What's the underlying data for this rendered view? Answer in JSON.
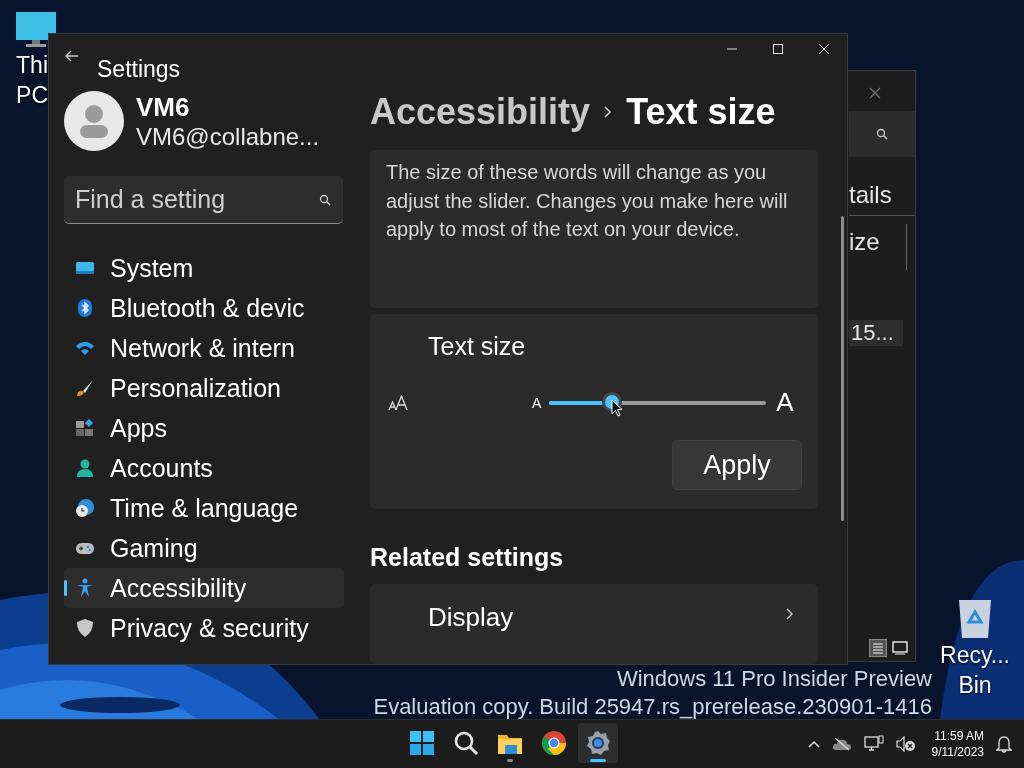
{
  "desktop": {
    "icons": [
      {
        "kind": "computer",
        "lines": [
          "Thi",
          "PC"
        ]
      },
      {
        "kind": "recycle_bin",
        "lines": [
          "Recy...",
          "Bin"
        ]
      }
    ],
    "watermark": [
      "Windows 11 Pro Insider Preview",
      "Evaluation copy. Build 25947.rs_prerelease.230901-1416"
    ]
  },
  "background_window": {
    "texts": [
      "tails",
      "ize",
      "15..."
    ]
  },
  "settings": {
    "window": {
      "title": "Settings"
    },
    "account": {
      "name": "VM6",
      "email": "VM6@collabne..."
    },
    "search": {
      "placeholder": "Find a setting"
    },
    "sidebar": {
      "items": [
        {
          "label": "System",
          "selected": false
        },
        {
          "label": "Bluetooth & devic",
          "selected": false
        },
        {
          "label": "Network & intern",
          "selected": false
        },
        {
          "label": "Personalization",
          "selected": false
        },
        {
          "label": "Apps",
          "selected": false
        },
        {
          "label": "Accounts",
          "selected": false
        },
        {
          "label": "Time & language",
          "selected": false
        },
        {
          "label": "Gaming",
          "selected": false
        },
        {
          "label": "Accessibility",
          "selected": true
        },
        {
          "label": "Privacy & security",
          "selected": false
        }
      ]
    },
    "breadcrumb": [
      "Accessibility",
      "Text size"
    ],
    "preview_text": "The size of these words will change as you adjust the slider. Changes you make here will apply to most of the text on your device.",
    "text_size": {
      "title": "Text size",
      "small_label": "A",
      "large_label": "A",
      "level": 0.29,
      "button": "Apply"
    },
    "related": {
      "heading": "Related settings",
      "items": [
        {
          "title": "Display"
        }
      ]
    }
  },
  "taskbar": {
    "apps": [
      {
        "kind": "start",
        "running": false,
        "active": false
      },
      {
        "kind": "search",
        "running": false,
        "active": false
      },
      {
        "kind": "explorer",
        "running": true,
        "active": false
      },
      {
        "kind": "browser",
        "running": false,
        "active": false
      },
      {
        "kind": "settings",
        "running": true,
        "active": true
      }
    ],
    "time": "11:59 AM",
    "date": "9/11/2023"
  }
}
